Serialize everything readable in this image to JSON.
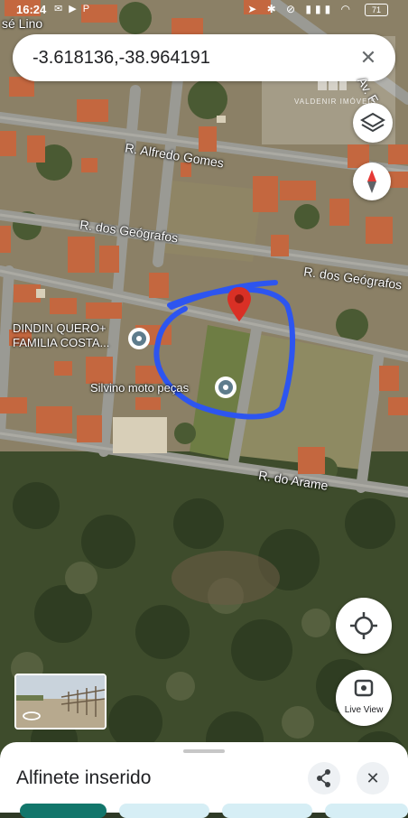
{
  "status": {
    "time": "16:24",
    "left_icons": "✉ ▶ P",
    "right_icons": "➤ ✱ ⊘ ▮▮▮ ◠",
    "battery": "71"
  },
  "search": {
    "coordinates": "-3.618136,-38.964191"
  },
  "watermark": {
    "text": "VALDENIR IMÓVEIS"
  },
  "map_labels": {
    "street_top_left": "sé Lino",
    "street_av": "Av. F",
    "street_alfredo": "R. Alfredo Gomes",
    "street_geografos_1": "R. dos Geógrafos",
    "street_geografos_2": "R. dos Geógrafos",
    "street_arame": "R. do Arame"
  },
  "pois": {
    "dindin_line1": "DINDIN QUERO+",
    "dindin_line2": "FAMILIA COSTA...",
    "silvino": "Silvino moto peças"
  },
  "buttons": {
    "live_view": "Live View"
  },
  "sheet": {
    "title": "Alfinete inserido"
  },
  "colors": {
    "pin_red": "#d93025",
    "scribble_blue": "#2d55f0",
    "compass_red": "#e53935"
  }
}
